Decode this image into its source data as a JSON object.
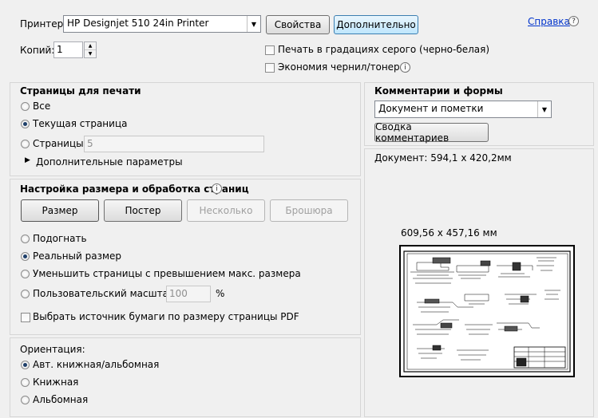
{
  "header": {
    "printer_label": "Принтер:",
    "printer_value": "HP Designjet 510 24in Printer",
    "properties_button": "Свойства",
    "advanced_button": "Дополнительно",
    "help_link": "Справка",
    "copies_label": "Копий:",
    "copies_value": "1",
    "grayscale_label": "Печать в градациях серого (черно-белая)",
    "ink_saver_label": "Экономия чернил/тонера"
  },
  "pages": {
    "title": "Страницы для печати",
    "all_label": "Все",
    "current_label": "Текущая страница",
    "pages_label": "Страницы",
    "pages_value": "5",
    "more_options_label": "Дополнительные параметры"
  },
  "sizing": {
    "title": "Настройка размера и обработка страниц",
    "tabs": [
      "Размер",
      "Постер",
      "Несколько",
      "Брошюра"
    ],
    "fit_label": "Подогнать",
    "actual_label": "Реальный размер",
    "shrink_label": "Уменьшить страницы с превышением макс. размера",
    "custom_label": "Пользовательский масштаб:",
    "custom_value": "100",
    "percent": "%",
    "paper_source_label": "Выбрать источник бумаги по размеру страницы PDF"
  },
  "orientation": {
    "title": "Ориентация:",
    "auto_label": "Авт. книжная/альбомная",
    "portrait_label": "Книжная",
    "landscape_label": "Альбомная"
  },
  "comments": {
    "title": "Комментарии и формы",
    "select_value": "Документ и пометки",
    "summary_button": "Сводка комментариев",
    "document_size": "Документ: 594,1 x 420,2мм",
    "preview_size": "609,56 x 457,16 мм"
  },
  "colors": {
    "accent": "#1e3f6a",
    "link": "#0033cc",
    "panel_border": "#d6d6d6"
  }
}
